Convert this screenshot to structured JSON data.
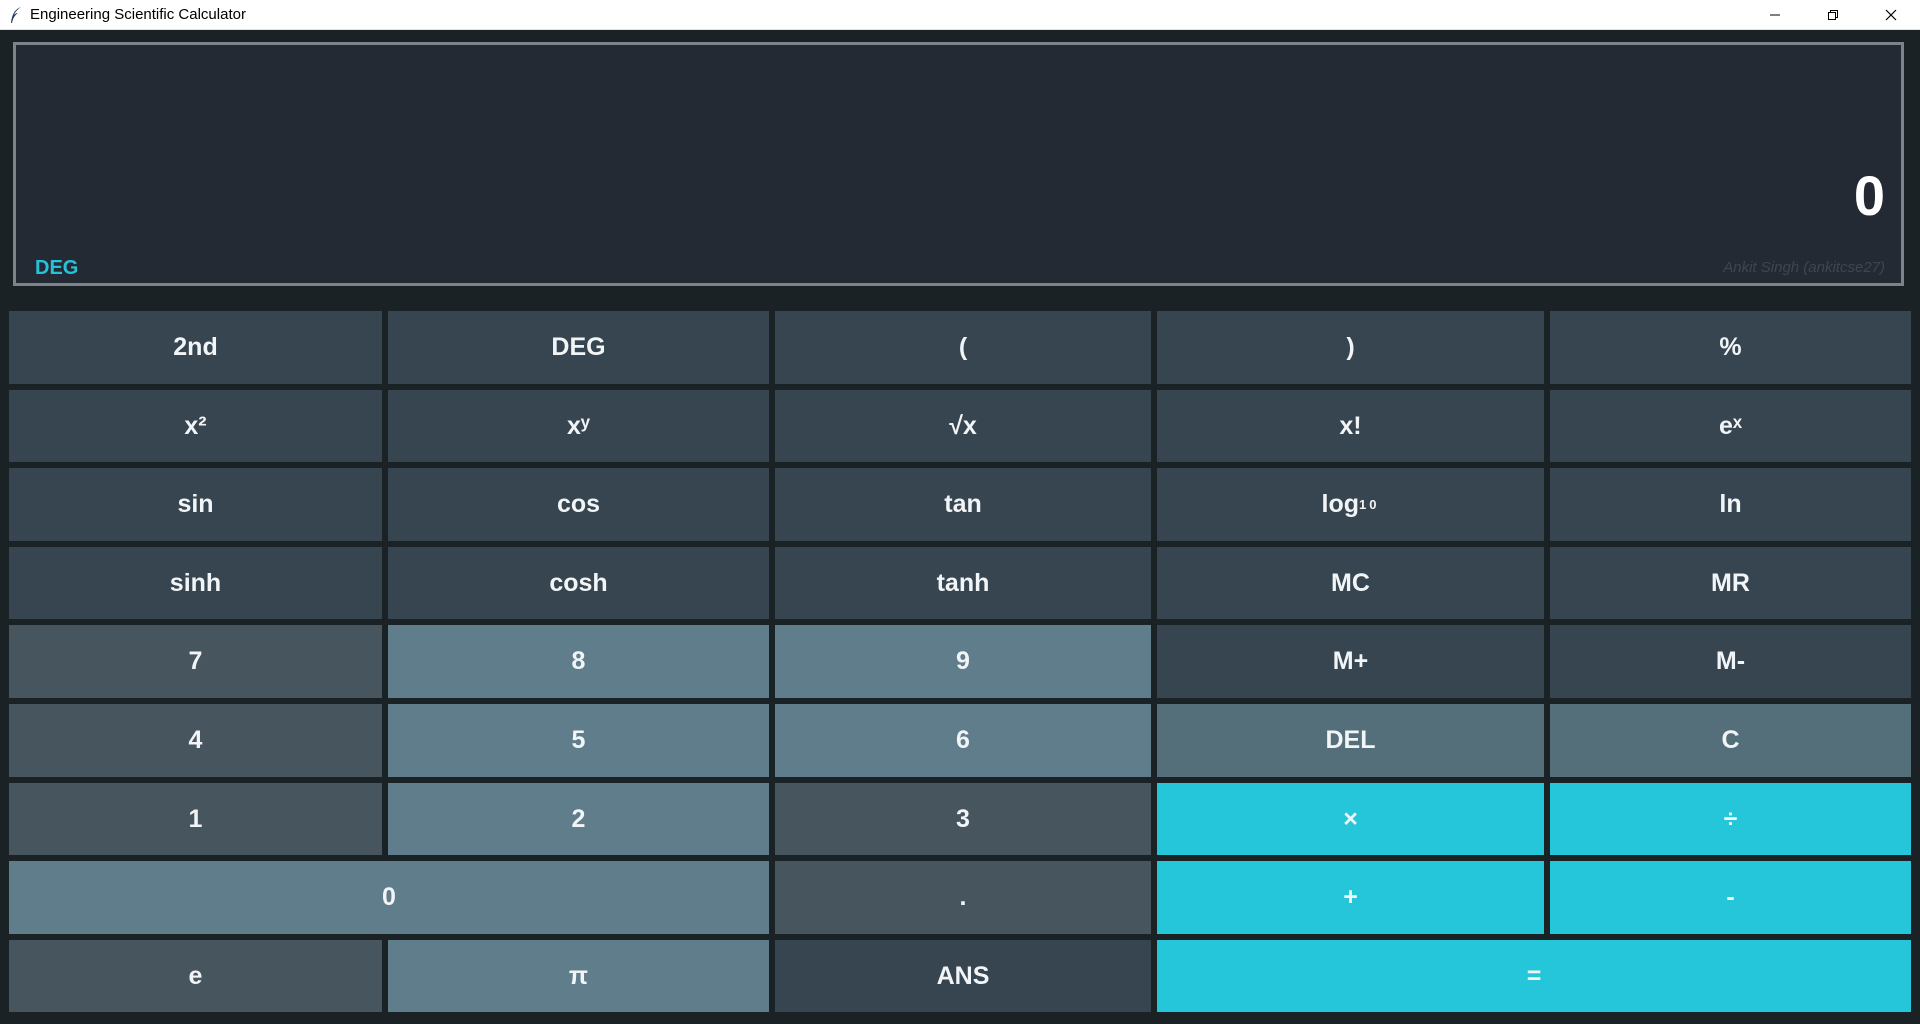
{
  "window": {
    "title": "Engineering Scientific Calculator",
    "controls": [
      "minimize",
      "restore",
      "close"
    ]
  },
  "display": {
    "value": "0",
    "mode": "DEG",
    "credit": "Ankit Singh (ankitcse27)",
    "mode_color": "#26c2d9"
  },
  "keys": {
    "second": "2nd",
    "deg": "DEG",
    "open_paren": "(",
    "close_paren": ")",
    "percent": "%",
    "square": "x²",
    "power": "xʸ",
    "sqrt": "√x",
    "factorial": "x!",
    "exp": "eˣ",
    "sin": "sin",
    "cos": "cos",
    "tan": "tan",
    "log10_base": "log",
    "log10_sub": "10",
    "ln": "ln",
    "sinh": "sinh",
    "cosh": "cosh",
    "tanh": "tanh",
    "mc": "MC",
    "mr": "MR",
    "seven": "7",
    "eight": "8",
    "nine": "9",
    "m_plus": "M+",
    "m_minus": "M-",
    "four": "4",
    "five": "5",
    "six": "6",
    "del": "DEL",
    "clear": "C",
    "one": "1",
    "two": "2",
    "three": "3",
    "multiply": "×",
    "divide": "÷",
    "zero": "0",
    "decimal": ".",
    "plus": "+",
    "minus": "-",
    "e": "e",
    "pi": "π",
    "ans": "ANS",
    "equals": "="
  },
  "colors": {
    "function_key": "#36454f",
    "number_key": "#607d8b",
    "alt_key": "#46555e",
    "edit_key": "#546e7a",
    "operator_key": "#26c6da"
  }
}
